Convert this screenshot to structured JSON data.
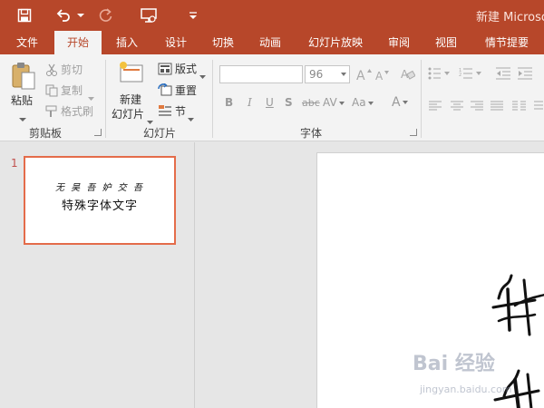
{
  "window": {
    "title": "新建 Microsoft"
  },
  "quick_access": {
    "items": [
      "save-icon",
      "undo-icon",
      "redo-icon",
      "present-from-start-icon",
      "customize-icon"
    ]
  },
  "tabs": [
    "文件",
    "开始",
    "插入",
    "设计",
    "切换",
    "动画",
    "幻灯片放映",
    "审阅",
    "视图",
    "情节提要"
  ],
  "active_tab": "开始",
  "clipboard": {
    "label": "剪贴板",
    "paste": "粘贴",
    "cut": "剪切",
    "copy": "复制",
    "format_painter": "格式刷"
  },
  "slides_group": {
    "label": "幻灯片",
    "new_slide_line1": "新建",
    "new_slide_line2": "幻灯片",
    "layout": "版式",
    "reset": "重置",
    "section": "节"
  },
  "font_group": {
    "label": "字体",
    "font_name": "",
    "font_size": "96",
    "bold": "B",
    "italic": "I",
    "underline": "U",
    "shadow": "S",
    "strikethrough": "abc",
    "char_spacing": "AV",
    "change_case": "Aa",
    "font_color": "A"
  },
  "thumbnail": {
    "number": "1",
    "line1": "无 吴 吾 妒 交 吾",
    "line2": "特殊字体文字"
  },
  "watermark": {
    "main": "Bai 经验",
    "sub": "jingyan.baidu.com"
  },
  "colors": {
    "accent": "#b7472a",
    "ribbon_bg": "#f3f3f3",
    "selected_thumb_border": "#e46c4a"
  }
}
